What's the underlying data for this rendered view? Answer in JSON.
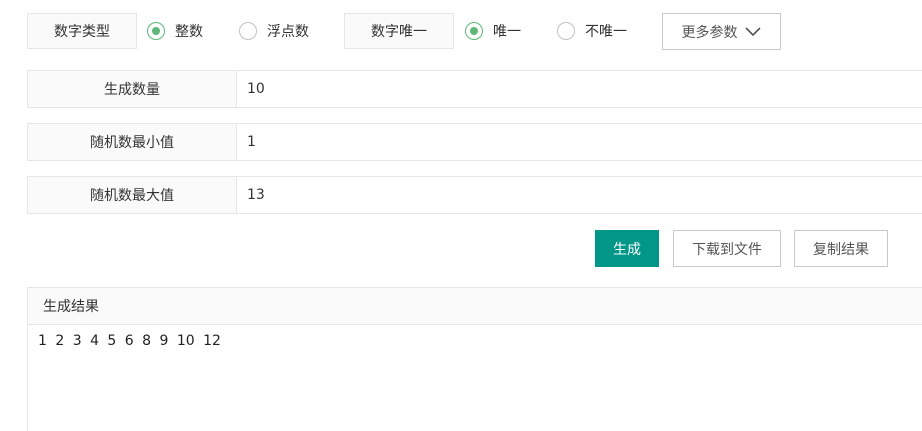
{
  "options": {
    "number_type": {
      "label": "数字类型",
      "choices": [
        {
          "label": "整数",
          "checked": true
        },
        {
          "label": "浮点数",
          "checked": false
        }
      ]
    },
    "uniqueness": {
      "label": "数字唯一",
      "choices": [
        {
          "label": "唯一",
          "checked": true
        },
        {
          "label": "不唯一",
          "checked": false
        }
      ]
    },
    "more_button": "更多参数"
  },
  "form": {
    "count": {
      "label": "生成数量",
      "value": "10"
    },
    "min": {
      "label": "随机数最小值",
      "value": "1"
    },
    "max": {
      "label": "随机数最大值",
      "value": "13"
    }
  },
  "actions": {
    "generate": "生成",
    "download": "下载到文件",
    "copy": "复制结果"
  },
  "result": {
    "title": "生成结果",
    "content": "1 2 3 4 5 6 8 9 10 12"
  },
  "colors": {
    "primary": "#009688",
    "radio_checked": "#5fb878"
  },
  "icons": {
    "more_button_icon": "chevron-down-icon"
  }
}
